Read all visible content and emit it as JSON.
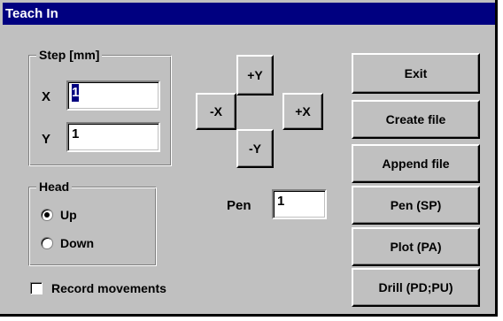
{
  "window": {
    "title": "Teach In"
  },
  "step": {
    "legend": "Step [mm]",
    "x_label": "X",
    "x_value": "1",
    "y_label": "Y",
    "y_value": "1"
  },
  "jog": {
    "plus_y": "+Y",
    "minus_x": "-X",
    "plus_x": "+X",
    "minus_y": "-Y"
  },
  "pen": {
    "label": "Pen",
    "value": "1"
  },
  "head": {
    "legend": "Head",
    "options": [
      {
        "label": "Up",
        "checked": true
      },
      {
        "label": "Down",
        "checked": false
      }
    ]
  },
  "record": {
    "label": "Record movements",
    "checked": false
  },
  "actions": {
    "exit": "Exit",
    "create_file": "Create file",
    "append_file": "Append file",
    "pen_sp": "Pen (SP)",
    "plot_pa": "Plot (PA)",
    "drill": "Drill (PD;PU)"
  }
}
